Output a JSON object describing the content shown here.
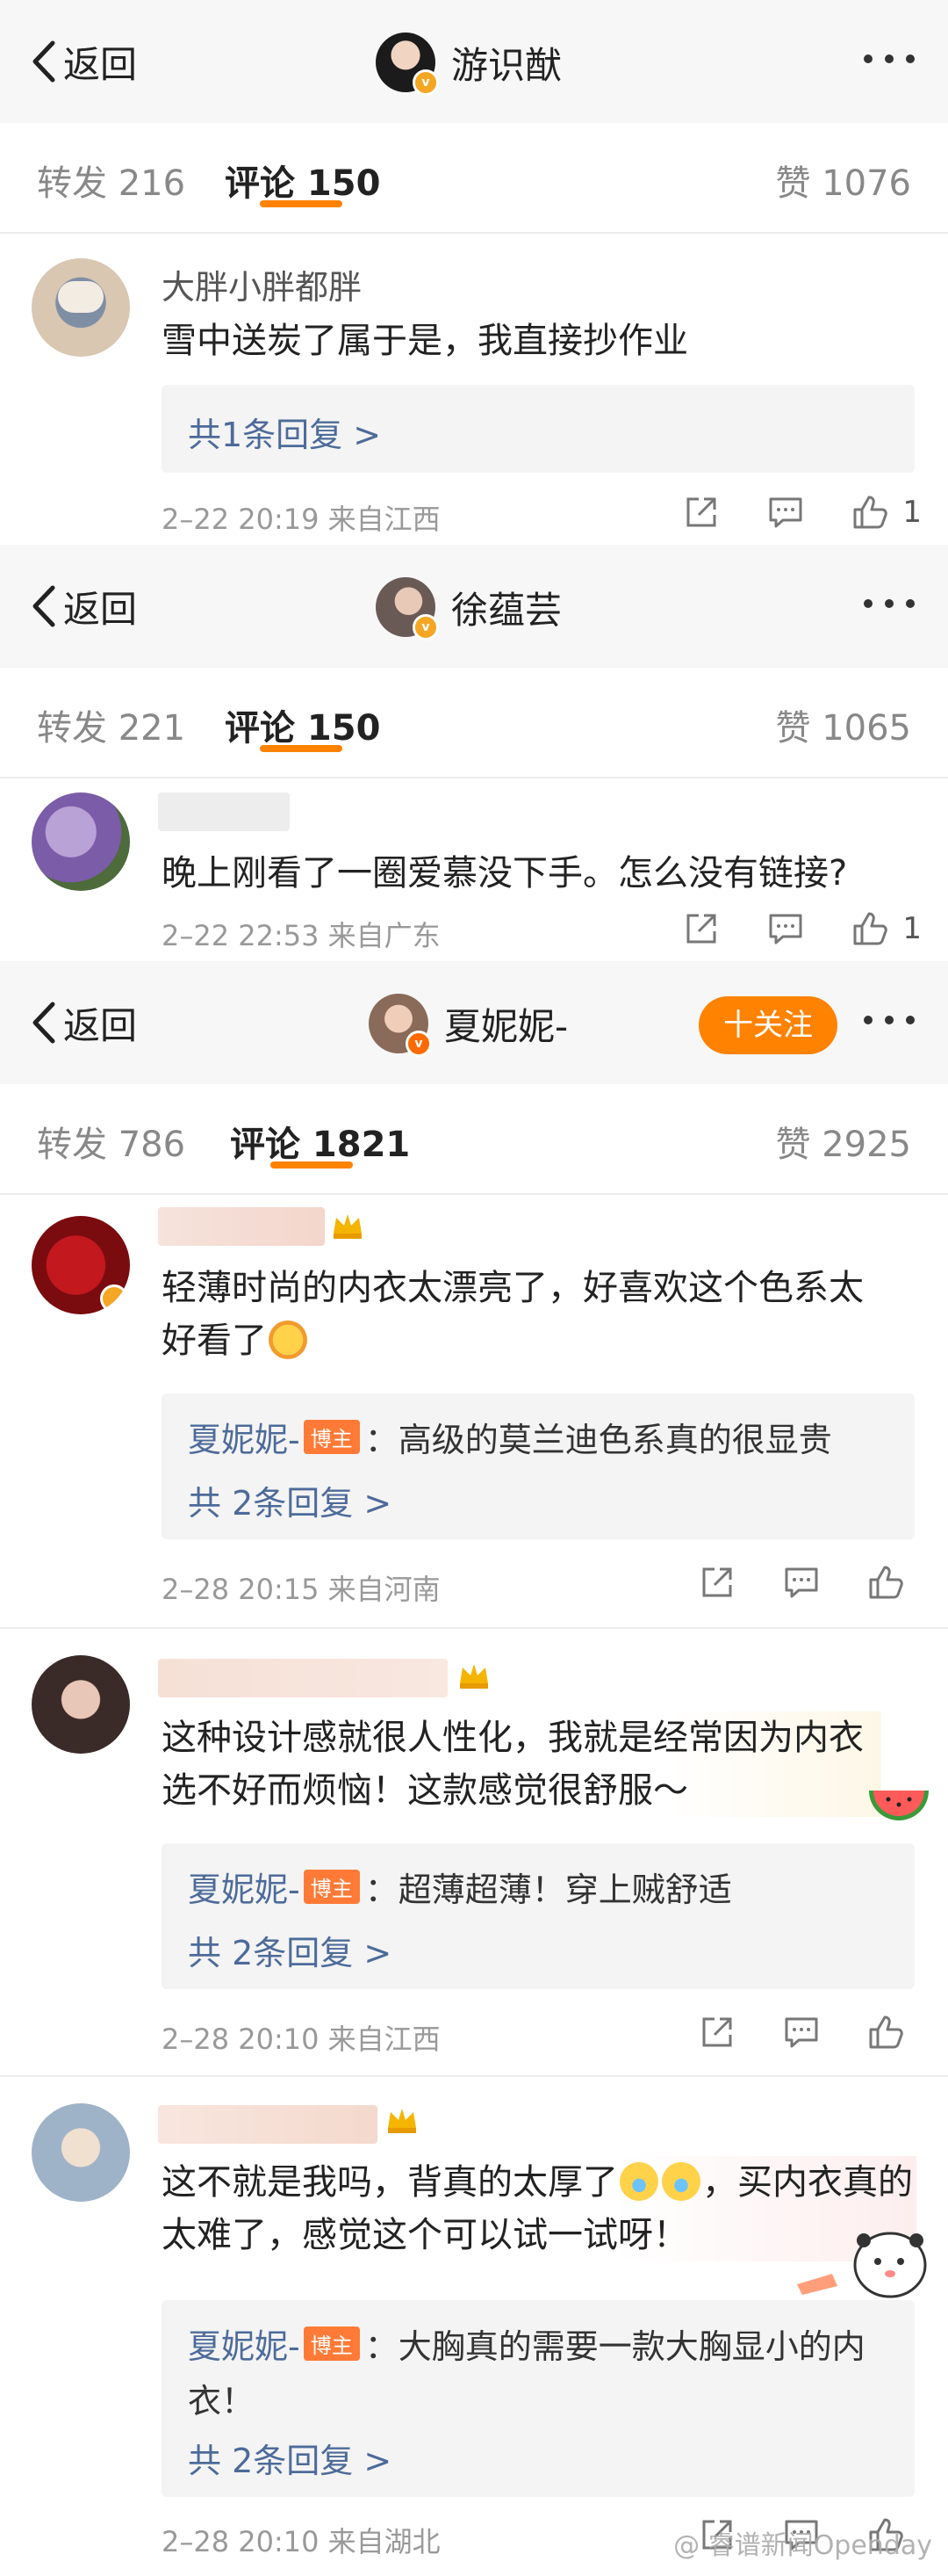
{
  "colors": {
    "accent": "#ff8200",
    "link": "#4d6b9a",
    "tag": "#ff7a36"
  },
  "panels": [
    {
      "back_label": "返回",
      "author_name": "游识猷",
      "tabs": {
        "repost": "转发 216",
        "comments": "评论 150",
        "likes": "赞 1076"
      },
      "comment": {
        "username": "大胖小胖都胖",
        "text": "雪中送炭了属于是，我直接抄作业",
        "reply_more": "共1条回复 >",
        "meta": "2–22 20:19  来自江西",
        "like_count": "1"
      }
    },
    {
      "back_label": "返回",
      "author_name": "徐蕴芸",
      "tabs": {
        "repost": "转发 221",
        "comments": "评论 150",
        "likes": "赞 1065"
      },
      "comment": {
        "text": "晚上刚看了一圈爱慕没下手。怎么没有链接?",
        "meta": "2–22 22:53  来自广东",
        "like_count": "1"
      }
    },
    {
      "back_label": "返回",
      "author_name": "夏妮妮-",
      "follow_label": "十关注",
      "tabs": {
        "repost": "转发 786",
        "comments": "评论 1821",
        "likes": "赞 2925"
      },
      "comments": [
        {
          "text": "轻薄时尚的内衣太漂亮了，好喜欢这个色系太好看了",
          "reply_author": "夏妮妮-",
          "reply_tag": "博主",
          "reply_text": "：高级的莫兰迪色系真的很显贵",
          "reply_more": "共 2条回复 >",
          "meta": "2–28 20:15  来自河南"
        },
        {
          "text": "这种设计感就很人性化，我就是经常因为内衣选不好而烦恼！这款感觉很舒服～",
          "reply_author": "夏妮妮-",
          "reply_tag": "博主",
          "reply_text": "：超薄超薄！穿上贼舒适",
          "reply_more": "共 2条回复 >",
          "meta": "2–28 20:10  来自江西"
        },
        {
          "text_a": "这不就是我吗，背真的太厚了",
          "text_b": "，买内衣真的太难了，感觉这个可以试一试呀！",
          "reply_author": "夏妮妮-",
          "reply_tag": "博主",
          "reply_text": "：大胸真的需要一款大胸显小的内",
          "reply_text_2": "衣！",
          "reply_more": "共 2条回复 >",
          "meta": "2–28 20:10  来自湖北"
        }
      ]
    }
  ],
  "watermark": "@ 睿谱新闻Openday",
  "icons": [
    "back-chevron-icon",
    "more-dots-icon",
    "share-icon",
    "comment-icon",
    "like-icon",
    "verified-badge-icon",
    "level-crown-icon"
  ]
}
